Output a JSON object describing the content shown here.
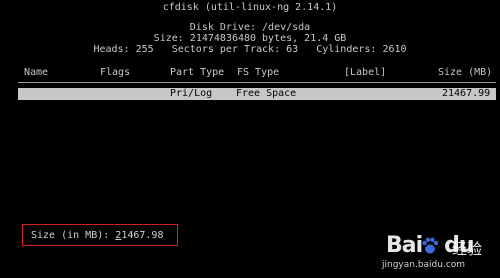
{
  "header": {
    "title": "cfdisk (util-linux-ng 2.14.1)",
    "disk_drive": "Disk Drive: /dev/sda",
    "size_line": "Size: 21474836480 bytes, 21.4 GB",
    "geometry_line": "Heads: 255   Sectors per Track: 63   Cylinders: 2610"
  },
  "table": {
    "columns": [
      "Name",
      "Flags",
      "Part Type",
      "FS Type",
      "[Label]",
      "Size (MB)"
    ],
    "rows": [
      {
        "name": "",
        "flags": "",
        "part_type": "Pri/Log",
        "fs_type": "Free Space",
        "label": "",
        "size_mb": "21467.99"
      }
    ]
  },
  "prompt": {
    "label": "Size (in MB): ",
    "value_cursor": "2",
    "value_rest": "1467.98"
  },
  "watermark": {
    "logo_text": "Bai",
    "logo_text2": "du",
    "cn_text": "经验",
    "url": "jingyan.baidu.com"
  },
  "colors": {
    "background": "#000000",
    "text": "#c8c8c8",
    "highlight": "#c7c7c7",
    "annotation_box": "#d02020"
  }
}
